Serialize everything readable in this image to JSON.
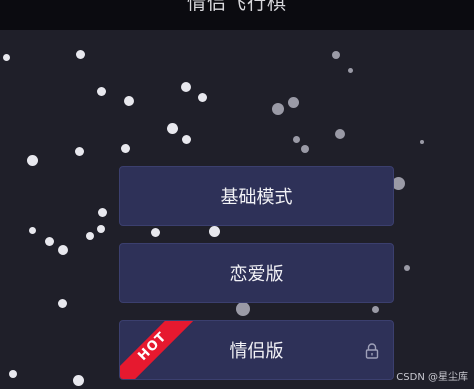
{
  "header": {
    "title": "情侣飞行棋"
  },
  "modes": [
    {
      "label": "基础模式",
      "locked": false,
      "badge": ""
    },
    {
      "label": "恋爱版",
      "locked": false,
      "badge": ""
    },
    {
      "label": "情侣版",
      "locked": true,
      "badge": "HOT"
    }
  ],
  "watermark": "CSDN @星尘库",
  "colors": {
    "background": "#1f1f29",
    "button": "#2e3158",
    "hot_badge": "#e6192f"
  },
  "icons": {
    "lock": "lock-icon"
  }
}
